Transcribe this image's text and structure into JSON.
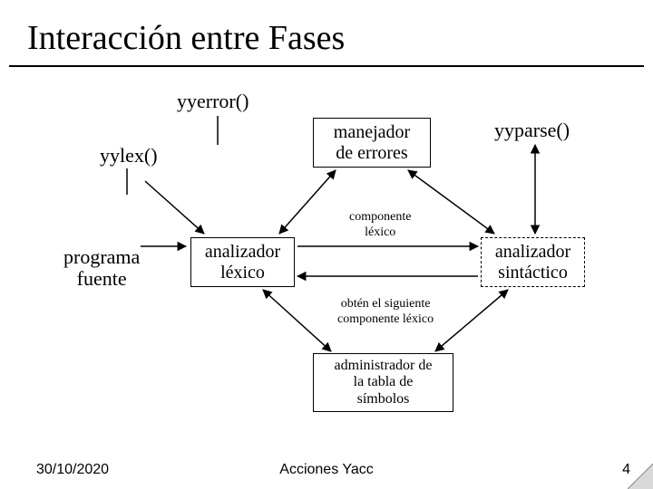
{
  "title": "Interacción entre Fases",
  "labels": {
    "yyerror": "yyerror()",
    "yylex": "yylex()",
    "yyparse": "yyparse()",
    "programa_fuente": "programa\nfuente"
  },
  "boxes": {
    "manejador": "manejador\nde errores",
    "analizador_lexico": "analizador\nléxico",
    "analizador_sintactico": "analizador\nsintáctico",
    "administrador": "administrador de\nla tabla de\nsímbolos"
  },
  "edge_labels": {
    "componente_lexico": "componente\nléxico",
    "obten_siguiente": "obtén el siguiente\ncomponente léxico"
  },
  "footer": {
    "date": "30/10/2020",
    "center": "Acciones Yacc",
    "page": "4"
  }
}
